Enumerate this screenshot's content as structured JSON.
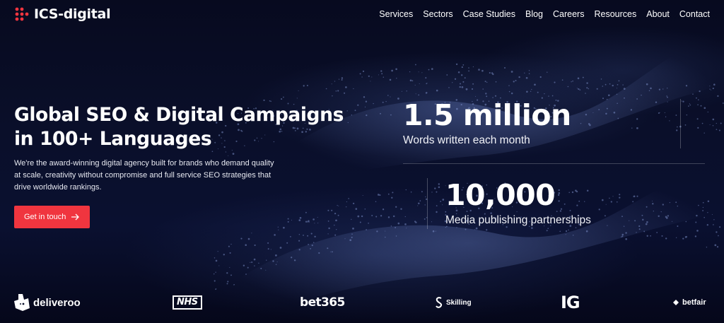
{
  "brand": {
    "name": "ICS-digital",
    "accent_color": "#f0353f",
    "logo_icon": "red-dot-grid-icon"
  },
  "nav": {
    "items": [
      "Services",
      "Sectors",
      "Case Studies",
      "Blog",
      "Careers",
      "Resources",
      "About",
      "Contact"
    ]
  },
  "hero": {
    "title_line1": "Global SEO & Digital Campaigns",
    "title_line2": "in 100+ Languages",
    "description": "We're the award-winning digital agency built for brands who demand quality at scale, creativity without compromise and full service SEO strategies that drive worldwide rankings.",
    "cta_label": "Get in touch",
    "cta_icon": "arrow-right-icon"
  },
  "stats": [
    {
      "value": "1.5 million",
      "label": "Words written each month"
    },
    {
      "value": "10,000",
      "label": "Media publishing partnerships"
    }
  ],
  "clients": {
    "deliveroo": "deliveroo",
    "nhs": "NHS",
    "bet365": "bet365",
    "skilling": "Skilling",
    "ig": "IG",
    "betfair": "betfair"
  }
}
